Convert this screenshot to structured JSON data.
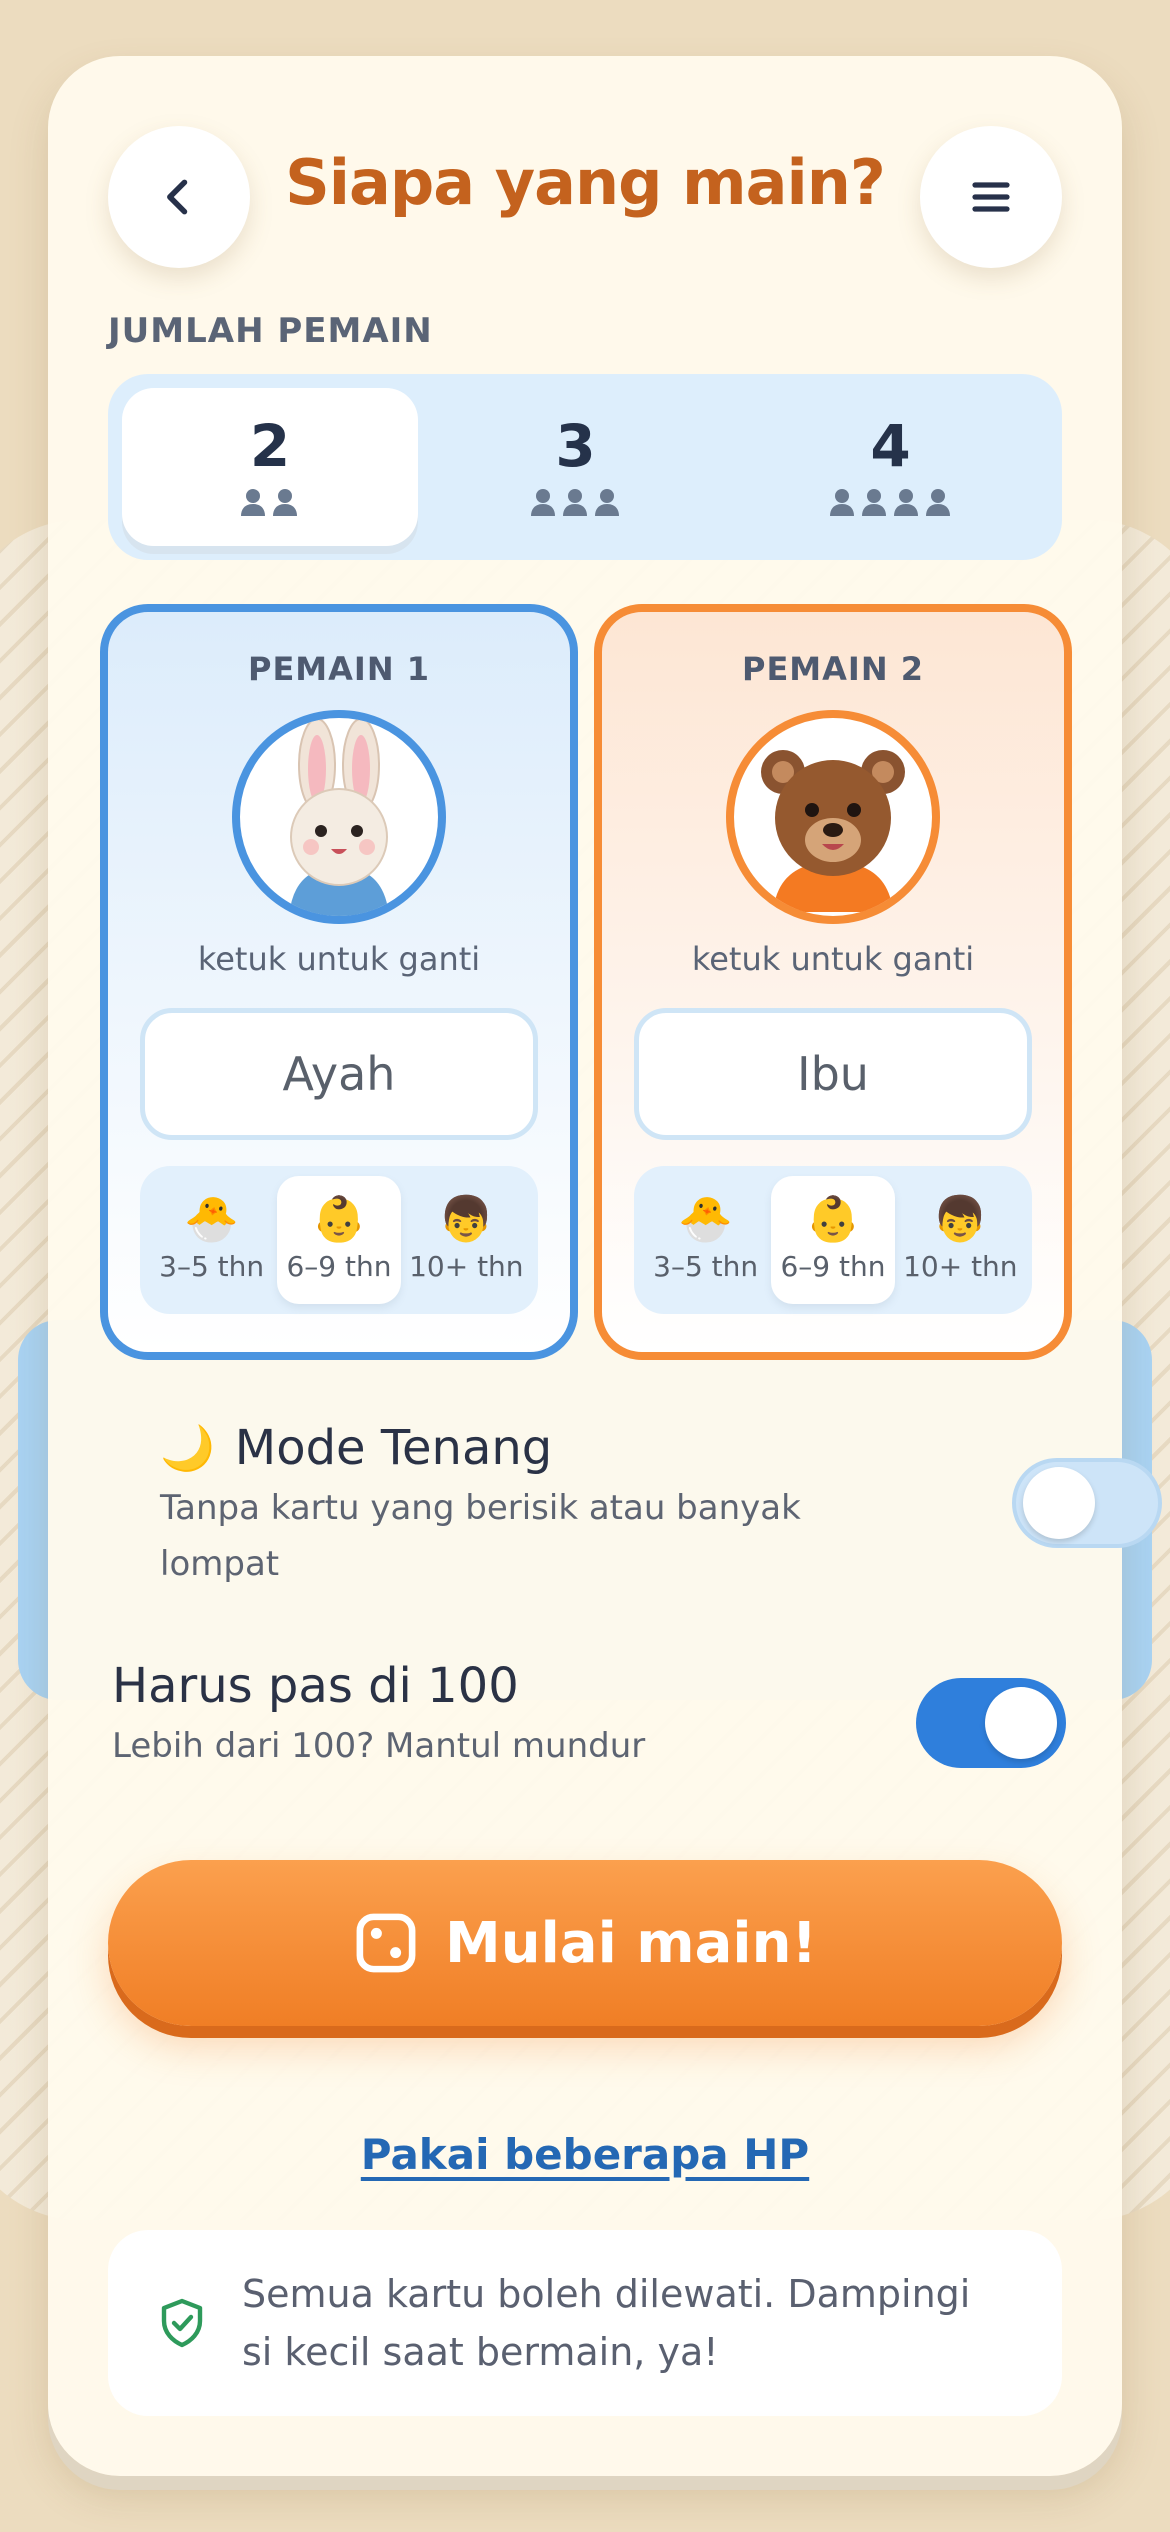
{
  "header": {
    "title": "Siapa yang main?"
  },
  "player_count": {
    "label": "JUMLAH PEMAIN",
    "options": [
      {
        "value": "2",
        "icons": "👤👤",
        "selected": true
      },
      {
        "value": "3",
        "icons": "👤👤👤",
        "selected": false
      },
      {
        "value": "4",
        "icons": "👤👤👤👤",
        "selected": false
      }
    ]
  },
  "players": [
    {
      "title": "PEMAIN 1",
      "avatar": "bunny-avatar",
      "hint": "ketuk untuk ganti",
      "name": "Ayah",
      "accent": "#4a94e0",
      "ages": [
        {
          "emoji": "🐣",
          "label": "3–5 thn",
          "selected": false
        },
        {
          "emoji": "👶",
          "label": "6–9 thn",
          "selected": true
        },
        {
          "emoji": "👦",
          "label": "10+ thn",
          "selected": false
        }
      ]
    },
    {
      "title": "PEMAIN 2",
      "avatar": "bear-avatar",
      "hint": "ketuk untuk ganti",
      "name": "Ibu",
      "accent": "#f68c36",
      "ages": [
        {
          "emoji": "🐣",
          "label": "3–5 thn",
          "selected": false
        },
        {
          "emoji": "👶",
          "label": "6–9 thn",
          "selected": true
        },
        {
          "emoji": "👦",
          "label": "10+ thn",
          "selected": false
        }
      ]
    }
  ],
  "settings": {
    "calm_mode": {
      "icon": "🌙",
      "title": "Mode Tenang",
      "desc": "Tanpa kartu yang berisik atau banyak lompat",
      "on": false
    },
    "exact_100": {
      "title": "Harus pas di 100",
      "desc": "Lebih dari 100? Mantul mundur",
      "on": true
    }
  },
  "start_button": {
    "label": "Mulai main!"
  },
  "multi_device_link": "Pakai beberapa HP",
  "note": {
    "text": "Semua kartu boleh dilewati. Dampingi si kecil saat bermain, ya!"
  },
  "colors": {
    "primary": "#f07e25",
    "title": "#c4621e",
    "blue": "#2f7fdc"
  }
}
